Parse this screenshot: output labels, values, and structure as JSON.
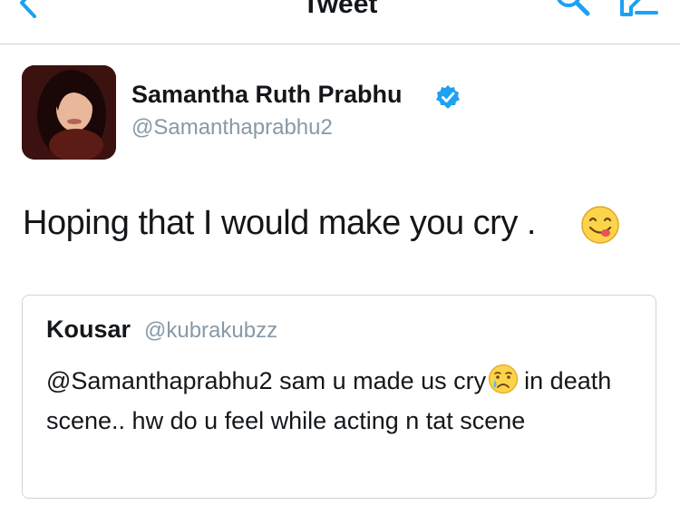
{
  "nav": {
    "title": "Tweet",
    "icons": {
      "back": "chevron-left-icon",
      "search": "search-icon",
      "compose": "compose-icon"
    }
  },
  "tweet": {
    "author_name": "Samantha Ruth Prabhu",
    "author_handle": "@Samanthaprabhu2",
    "verified": true,
    "text": "Hoping that I would make you cry .",
    "emoji": "face-savoring-food-emoji"
  },
  "quote": {
    "name": "Kousar",
    "handle": "@kubrakubzz",
    "text_before_emoji": "@Samanthaprabhu2 sam u made us cry",
    "emoji": "crying-face-emoji",
    "text_after_emoji": "in death scene.. hw do u feel while acting n tat scene"
  },
  "colors": {
    "accent": "#1da1f2",
    "text": "#14171a",
    "secondary_text": "#8899a6",
    "border": "#cfd6dc"
  }
}
